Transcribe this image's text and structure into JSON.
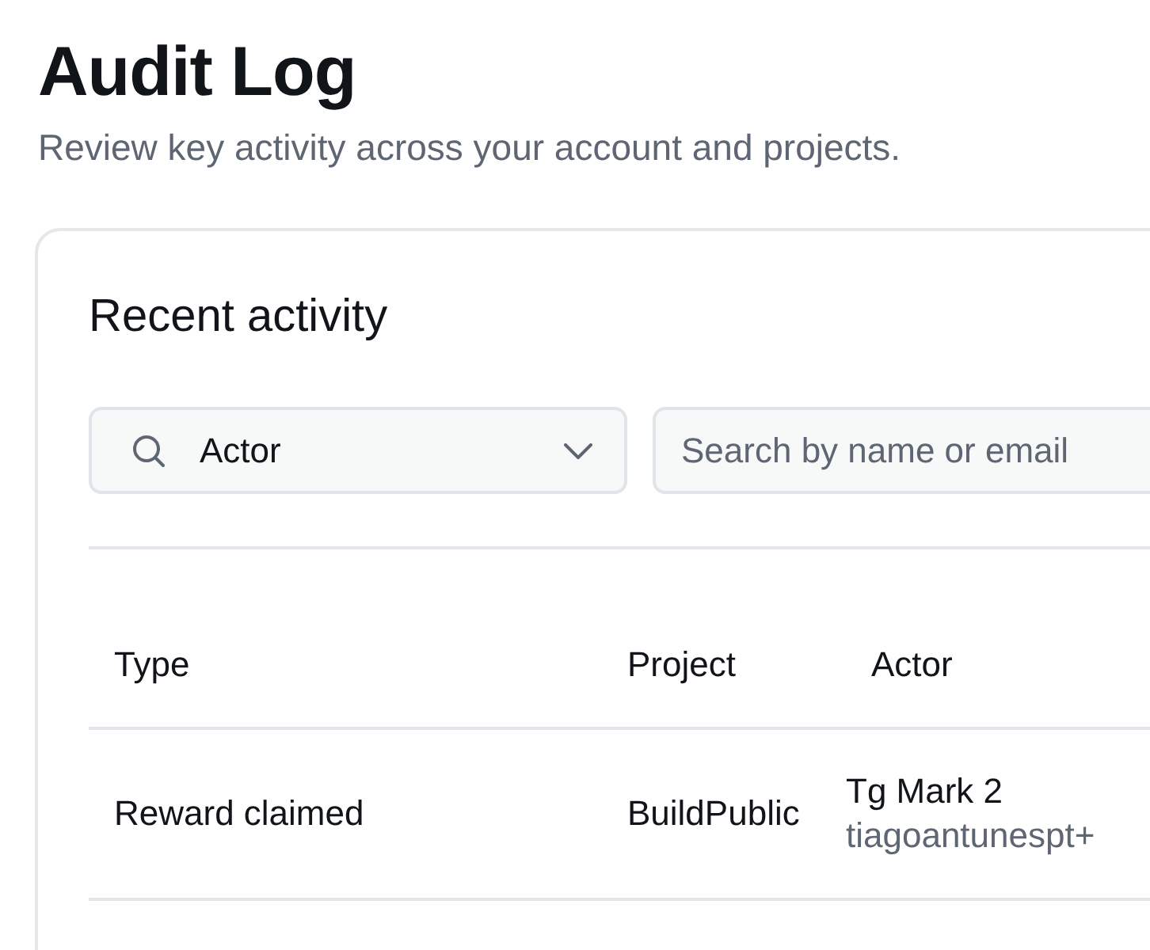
{
  "page": {
    "title": "Audit Log",
    "subtitle": "Review key activity across your account and projects."
  },
  "card": {
    "title": "Recent activity",
    "filter": {
      "value": "Actor"
    },
    "search": {
      "placeholder": "Search by name or email"
    },
    "table": {
      "columns": [
        "Type",
        "Project",
        "Actor"
      ],
      "rows": [
        {
          "type": "Reward claimed",
          "project": "BuildPublic",
          "actor_name": "Tg Mark 2",
          "actor_email": "tiagoantunespt+"
        }
      ]
    }
  }
}
